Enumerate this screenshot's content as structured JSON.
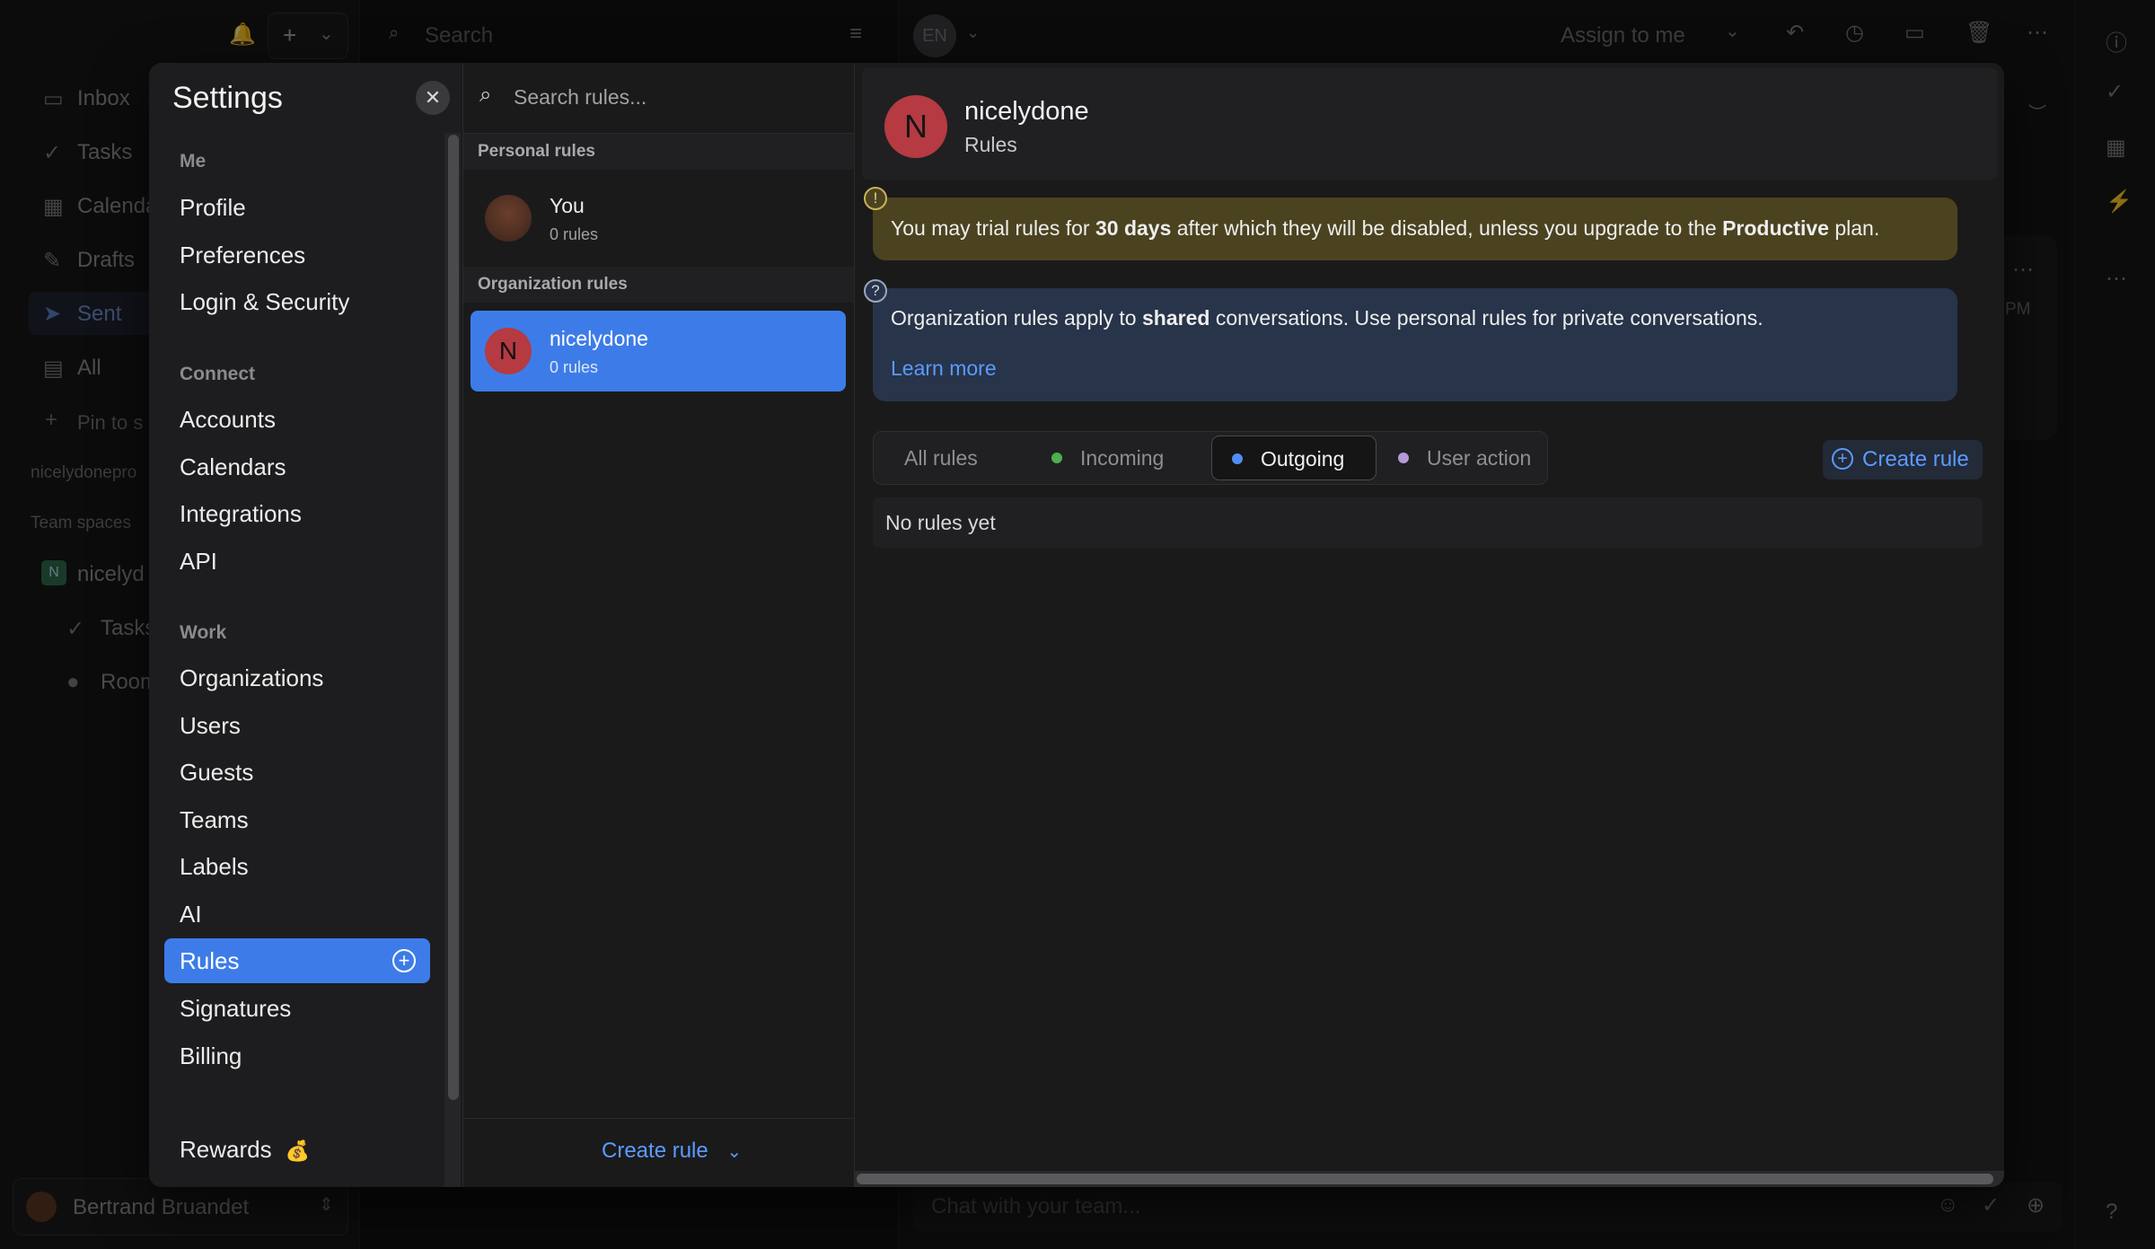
{
  "background": {
    "topbar": {
      "search_placeholder": "Search",
      "avatar_initials": "EN",
      "assign_label": "Assign to me"
    },
    "sidebar": {
      "items": [
        "Inbox",
        "Tasks",
        "Calendar",
        "Drafts",
        "Sent",
        "All",
        "Pin to s"
      ],
      "workspace_label": "nicelydonepro",
      "team_spaces_label": "Team spaces",
      "team_name": "nicelyd",
      "team_avatar": "N",
      "team_items": [
        "Tasks",
        "Room"
      ],
      "user_name": "Bertrand Bruandet"
    },
    "main": {
      "time_fragment": "PM",
      "chat_placeholder": "Chat with your team..."
    }
  },
  "settings": {
    "title": "Settings",
    "close_icon": "close-icon",
    "sections": [
      {
        "label": "Me",
        "items": [
          "Profile",
          "Preferences",
          "Login & Security"
        ]
      },
      {
        "label": "Connect",
        "items": [
          "Accounts",
          "Calendars",
          "Integrations",
          "API"
        ]
      },
      {
        "label": "Work",
        "items": [
          "Organizations",
          "Users",
          "Guests",
          "Teams",
          "Labels",
          "AI",
          "Rules",
          "Signatures",
          "Billing"
        ]
      }
    ],
    "active_item": "Rules",
    "rewards": {
      "label": "Rewards",
      "emoji": "💰"
    }
  },
  "rules_list": {
    "search_placeholder": "Search rules...",
    "personal_header": "Personal rules",
    "personal": {
      "name": "You",
      "count": "0 rules"
    },
    "org_header": "Organization rules",
    "org": {
      "avatar": "N",
      "name": "nicelydone",
      "count": "0 rules"
    },
    "footer_button": "Create rule"
  },
  "detail": {
    "org_avatar": "N",
    "org_name": "nicelydone",
    "subtitle": "Rules",
    "trial": {
      "pre": "You may trial rules for ",
      "days": "30 days",
      "mid": " after which they will be disabled, unless you upgrade to the ",
      "plan": "Productive",
      "post": " plan."
    },
    "info": {
      "pre": "Organization rules apply to ",
      "shared": "shared",
      "post": " conversations. Use personal rules for private conversations.",
      "link": "Learn more"
    },
    "filters": [
      {
        "label": "All rules",
        "dot": ""
      },
      {
        "label": "Incoming",
        "dot": "#4caf50"
      },
      {
        "label": "Outgoing",
        "dot": "#4f8ff7"
      },
      {
        "label": "User action",
        "dot": "#b69ad8"
      }
    ],
    "selected_filter": "Outgoing",
    "create_button": "Create rule",
    "empty_text": "No rules yet"
  },
  "colors": {
    "accent": "#3d7ce8",
    "link": "#5b9bff",
    "org_avatar": "#b53a42",
    "trial_bg": "#4b4320",
    "info_bg": "#27344a"
  }
}
